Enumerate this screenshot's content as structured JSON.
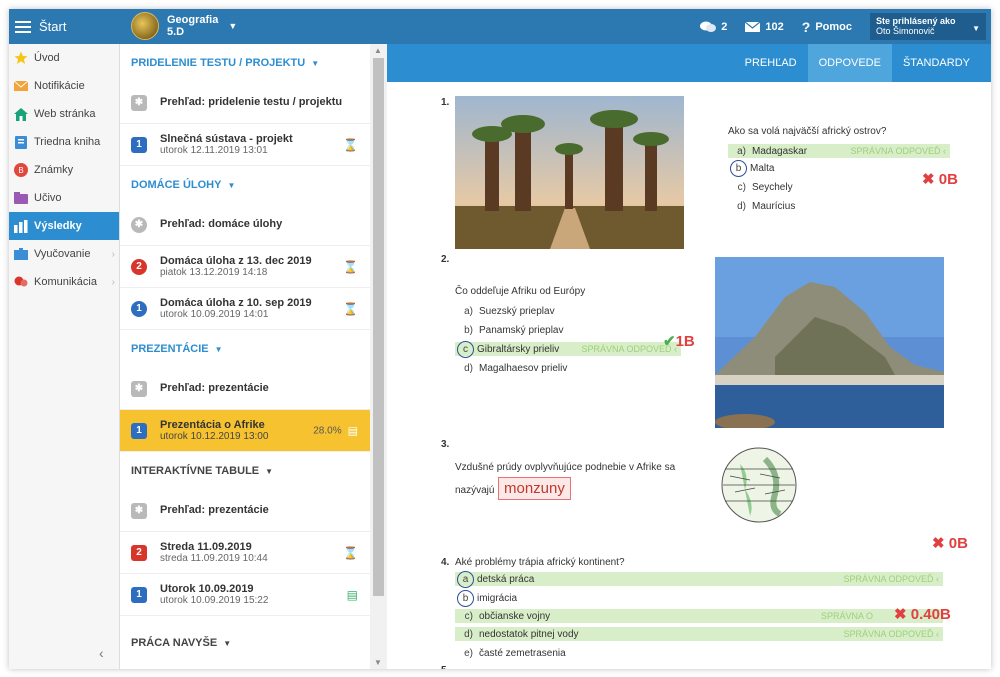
{
  "topbar": {
    "start_label": "Štart",
    "subject_name": "Geografia",
    "subject_class": "5.D",
    "messages_count": "2",
    "mail_count": "102",
    "help_label": "Pomoc",
    "user_line1": "Ste prihlásený ako",
    "user_line2": "Oto Šimonovič"
  },
  "sidebar": {
    "items": [
      {
        "label": "Úvod",
        "icon": "star-icon"
      },
      {
        "label": "Notifikácie",
        "icon": "envelope-icon"
      },
      {
        "label": "Web stránka",
        "icon": "home-icon"
      },
      {
        "label": "Triedna kniha",
        "icon": "book-icon"
      },
      {
        "label": "Známky",
        "icon": "grades-icon"
      },
      {
        "label": "Učivo",
        "icon": "folder-icon"
      },
      {
        "label": "Výsledky",
        "icon": "results-icon"
      },
      {
        "label": "Vyučovanie",
        "icon": "teaching-icon"
      },
      {
        "label": "Komunikácia",
        "icon": "chat-icon"
      }
    ]
  },
  "list": {
    "sections": [
      {
        "title": "PRIDELENIE TESTU / PROJEKTU"
      },
      {
        "title": "DOMÁCE ÚLOHY"
      },
      {
        "title": "PREZENTÁCIE"
      },
      {
        "title": "INTERAKTÍVNE TABULE"
      },
      {
        "title": "PRÁCA NAVYŠE"
      }
    ],
    "items": [
      {
        "title": "Prehľad: pridelenie testu / projektu",
        "sub": ""
      },
      {
        "badge": "1",
        "title": "Slnečná sústava - projekt",
        "sub": "utorok 12.11.2019 13:01"
      },
      {
        "title": "Prehľad: domáce úlohy",
        "sub": ""
      },
      {
        "badge": "2",
        "title": "Domáca úloha z 13. dec 2019",
        "sub": "piatok 13.12.2019 14:18"
      },
      {
        "badge": "1",
        "title": "Domáca úloha z 10. sep 2019",
        "sub": "utorok 10.09.2019 14:01"
      },
      {
        "title": "Prehľad: prezentácie",
        "sub": ""
      },
      {
        "badge": "1",
        "title": "Prezentácia o Afrike",
        "sub": "utorok 10.12.2019 13:00",
        "percent": "28.0%"
      },
      {
        "title": "Prehľad: prezentácie",
        "sub": ""
      },
      {
        "badge": "2",
        "title": "Streda 11.09.2019",
        "sub": "streda 11.09.2019 10:44"
      },
      {
        "badge": "1",
        "title": "Utorok 10.09.2019",
        "sub": "utorok 10.09.2019 15:22"
      }
    ]
  },
  "tabs": [
    {
      "label": "PREHĽAD"
    },
    {
      "label": "ODPOVEDE"
    },
    {
      "label": "ŠTANDARDY"
    }
  ],
  "questions": {
    "q1": {
      "num": "1.",
      "text": "Ako sa volá najväčší africký ostrov?",
      "options": [
        {
          "letter": "a)",
          "text": "Madagaskar"
        },
        {
          "letter": "b",
          "text": "Malta"
        },
        {
          "letter": "c)",
          "text": "Seychely"
        },
        {
          "letter": "d)",
          "text": "Maurícius"
        }
      ],
      "correct_label": "SPRÁVNA ODPOVEĎ",
      "score": "0B"
    },
    "q2": {
      "num": "2.",
      "text": "Čo oddeľuje Afriku od Európy",
      "options": [
        {
          "letter": "a)",
          "text": "Suezský prieplav"
        },
        {
          "letter": "b)",
          "text": "Panamský prieplav"
        },
        {
          "letter": "c",
          "text": "Gibraltársky prieliv"
        },
        {
          "letter": "d)",
          "text": "Magalhaesov prieliv"
        }
      ],
      "correct_label": "SPRÁVNA ODPOVEĎ",
      "score": "1B"
    },
    "q3": {
      "num": "3.",
      "text1": "Vzdušné prúdy ovplyvňujúce podnebie v Afrike sa",
      "text2": "nazývajú",
      "answer": "monzuny",
      "score": "0B"
    },
    "q4": {
      "num": "4.",
      "text": "Aké problémy trápia africký kontinent?",
      "options": [
        {
          "letter": "a",
          "text": "detská práca"
        },
        {
          "letter": "b",
          "text": "imigrácia"
        },
        {
          "letter": "c)",
          "text": "občianske vojny"
        },
        {
          "letter": "d)",
          "text": "nedostatok pitnej vody"
        },
        {
          "letter": "e)",
          "text": "časté zemetrasenia"
        }
      ],
      "correct_label": "SPRÁVNA ODPOVEĎ",
      "correct_label_trunc": "SPRÁVNA O",
      "score": "0.40B"
    },
    "q5_num": "5."
  }
}
